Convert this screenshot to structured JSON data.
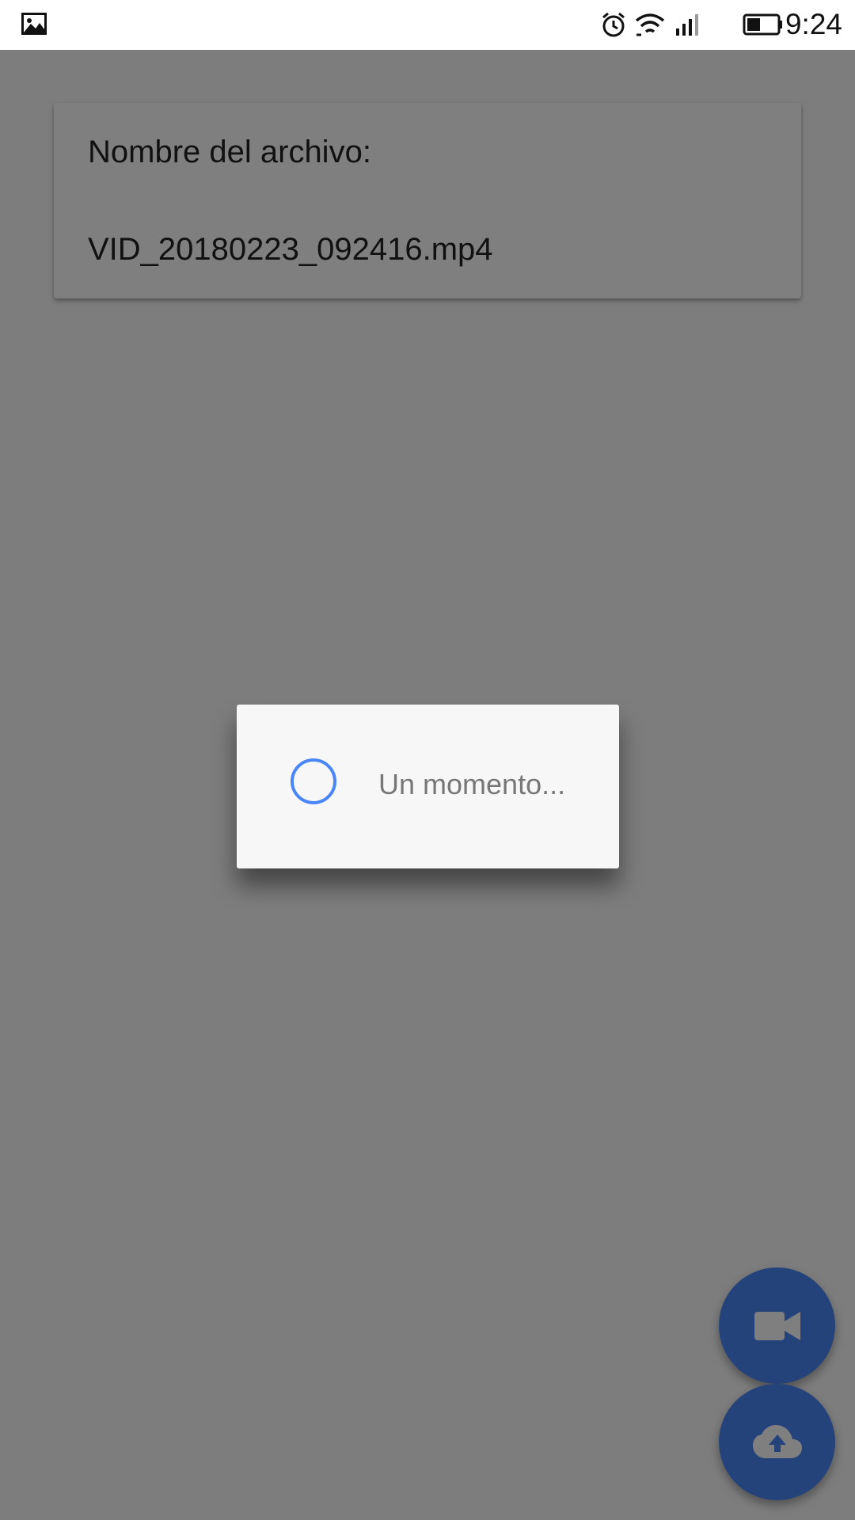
{
  "status_bar": {
    "time": "9:24",
    "icons": [
      "image-notification-icon",
      "alarm-icon",
      "wifi-icon",
      "signal-icon",
      "battery-icon"
    ]
  },
  "file_card": {
    "label": "Nombre del archivo:",
    "filename": "VID_20180223_092416.mp4"
  },
  "fabs": {
    "record_icon": "videocam-icon",
    "upload_icon": "cloud-upload-icon"
  },
  "dialog": {
    "message": "Un momento..."
  },
  "colors": {
    "accent": "#4a86f7",
    "scrim": "rgba(0,0,0,0.5)"
  }
}
